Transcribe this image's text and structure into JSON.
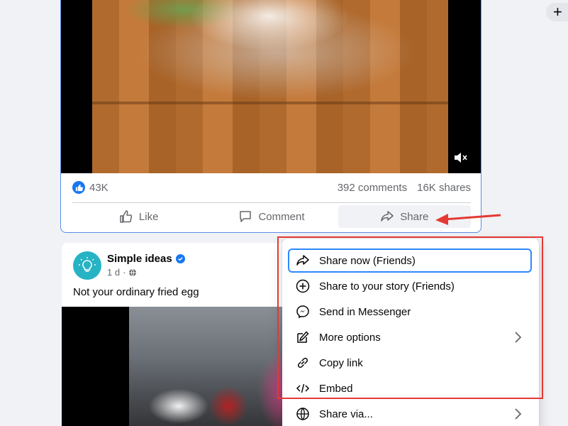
{
  "post1": {
    "reactions_count": "43K",
    "comments_count": "392 comments",
    "shares_count": "16K shares",
    "actions": {
      "like_label": "Like",
      "comment_label": "Comment",
      "share_label": "Share"
    }
  },
  "post2": {
    "author": "Simple ideas",
    "time": "1 d",
    "caption": "Not your ordinary fried egg"
  },
  "share_menu": {
    "items": [
      {
        "label": "Share now (Friends)",
        "icon": "share-arrow-icon"
      },
      {
        "label": "Share to your story (Friends)",
        "icon": "add-circle-icon"
      },
      {
        "label": "Send in Messenger",
        "icon": "messenger-icon"
      },
      {
        "label": "More options",
        "icon": "edit-icon"
      },
      {
        "label": "Copy link",
        "icon": "link-icon"
      },
      {
        "label": "Embed",
        "icon": "code-icon"
      },
      {
        "label": "Share via...",
        "icon": "globe-icon"
      }
    ]
  },
  "colors": {
    "accent": "#1877f2",
    "annotation_red": "#e53935",
    "focus_ring": "#2d88ff"
  }
}
